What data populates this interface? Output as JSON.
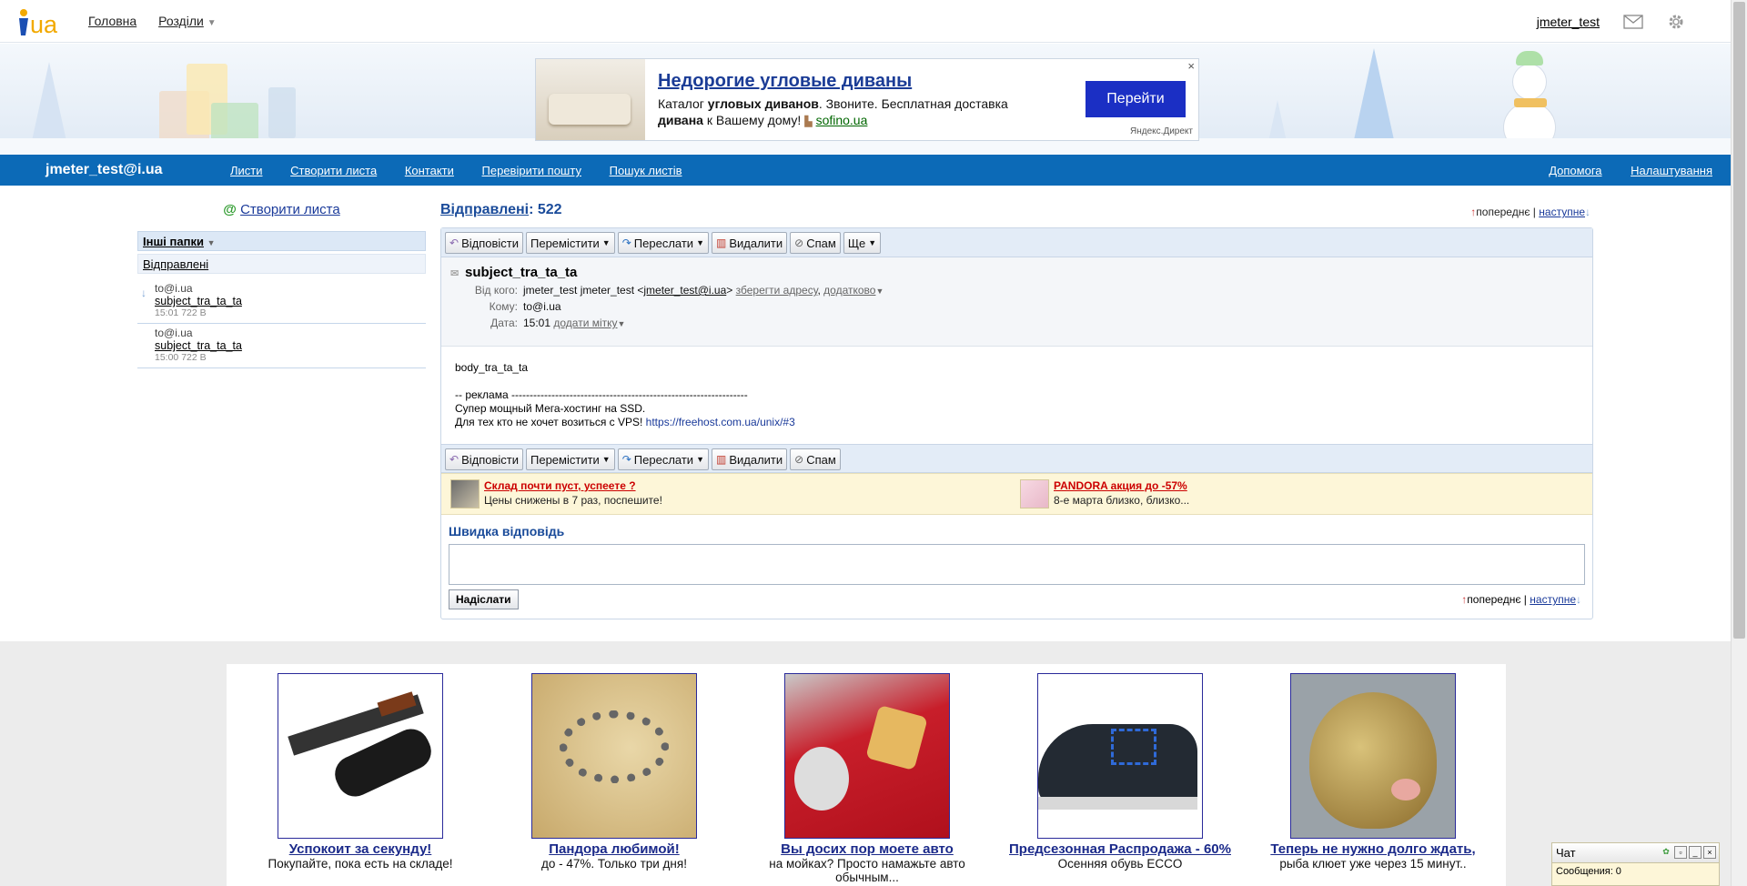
{
  "topbar": {
    "logo_text": "ua",
    "nav": [
      "Головна",
      "Розділи"
    ],
    "dropdown_arrow": "▼",
    "user": "jmeter_test",
    "icons": [
      "mail-icon",
      "gear-icon"
    ]
  },
  "ad": {
    "title": "Недорогие угловые диваны",
    "text_1": "Каталог ",
    "text_b1": "угловых диванов",
    "text_2": ". Звоните. Бесплатная доставка ",
    "text_b2": "дивана",
    "text_3": " к Вашему дому!",
    "link": "sofino.ua",
    "button": "Перейти",
    "footer": "Яндекс.Директ",
    "close": "×"
  },
  "bluebar": {
    "email": "jmeter_test@i.ua",
    "nav": [
      "Листи",
      "Створити листа",
      "Контакти",
      "Перевірити пошту",
      "Пошук листів"
    ],
    "right": [
      "Допомога",
      "Налаштування"
    ]
  },
  "sidebar": {
    "compose_at": "@",
    "compose_label": "Створити листа",
    "folders_label": "Інші папки",
    "sent_label": "Відправлені",
    "messages": [
      {
        "to": "to@i.ua",
        "subject": "subject_tra_ta_ta",
        "meta": "15:01 722 B"
      },
      {
        "to": "to@i.ua",
        "subject": "subject_tra_ta_ta",
        "meta": "15:00 722 B"
      }
    ]
  },
  "main": {
    "folder_title": "Відправлені",
    "count": ": 522",
    "prev": "попереднє",
    "next": "наступне",
    "toolbar": {
      "reply": "Відповісти",
      "move": "Перемістити",
      "forward": "Переслати",
      "delete": "Видалити",
      "spam": "Спам",
      "more": "Ще"
    },
    "message": {
      "subject": "subject_tra_ta_ta",
      "from_label": "Від кого:",
      "from_name": "jmeter_test jmeter_test <",
      "from_email": "jmeter_test@i.ua",
      "from_close": ">",
      "save_address": "зберегти адресу",
      "more": "додатково",
      "to_label": "Кому:",
      "to_value": "to@i.ua",
      "date_label": "Дата:",
      "date_value": "15:01",
      "add_tag": "додати мітку",
      "body_lines": [
        "body_tra_ta_ta",
        "",
        "-- реклама -----------------------------------------------------------------",
        "Супер мощный Мега-хостинг на SSD.",
        "Для тех кто не хочет возиться с VPS! "
      ],
      "body_link": "https://freehost.com.ua/unix/#3"
    },
    "promos": [
      {
        "title": "Склад почти пуст, успеете ?",
        "desc": "Цены снижены в 7 раз, поспешите!"
      },
      {
        "title": "PANDORA акция до -57%",
        "desc": "8-е марта близко, близко..."
      }
    ],
    "quick_reply_title": "Швидка відповідь",
    "send_label": "Надіслати"
  },
  "ads_bottom": [
    {
      "title": "Успокоит за секунду!",
      "desc": "Покупайте, пока есть на складе!"
    },
    {
      "title": "Пандора любимой!",
      "desc": "до - 47%. Только три дня!"
    },
    {
      "title": "Вы досих пор моете авто",
      "desc": "на мойках? Просто намажьте авто обычным..."
    },
    {
      "title": "Предсезонная Распродажа - 60%",
      "desc": "Осенняя обувь ECCO"
    },
    {
      "title": "Теперь не нужно долго ждать,",
      "desc": "рыба клюет уже через 15 минут.."
    }
  ],
  "chat": {
    "title": "Чат",
    "messages_label": "Сообщения: 0"
  },
  "colors": {
    "accent_blue": "#0c6ab7",
    "ad_button": "#1b2fc4",
    "promo_bg": "#fdf6d8"
  }
}
